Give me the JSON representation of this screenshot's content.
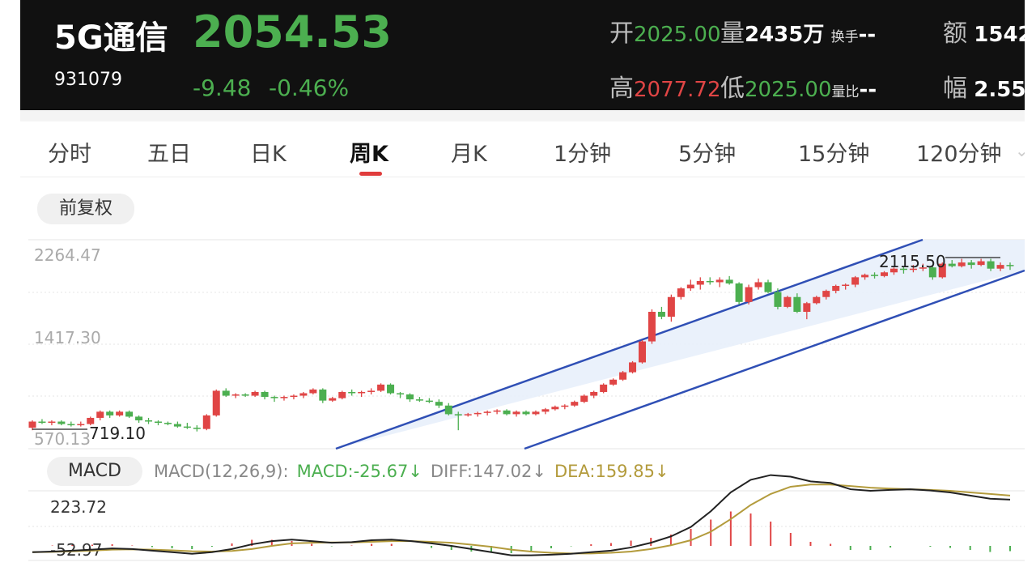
{
  "header": {
    "name": "5G通信",
    "code": "931079",
    "price": "2054.53",
    "change": "-9.48",
    "change_pct": "-0.46%",
    "open_label": "开",
    "open": "2025.00",
    "volume_label": "量",
    "volume": "2435万",
    "turnover_label": "换手",
    "turnover": "--",
    "amount_label": "额",
    "amount": "1542",
    "high_label": "高",
    "high": "2077.72",
    "low_label": "低",
    "low": "2025.00",
    "vol_ratio_label": "量比",
    "vol_ratio": "--",
    "amplitude_label": "幅",
    "amplitude": "2.55",
    "colors": {
      "up": "#e04545",
      "down": "#4caf50"
    }
  },
  "tabs": [
    "分时",
    "五日",
    "日K",
    "周K",
    "月K",
    "1分钟",
    "5分钟",
    "15分钟",
    "120分钟"
  ],
  "active_tab": "周K",
  "adjust_button": "前复权",
  "macd": {
    "button": "MACD",
    "params": "MACD(12,26,9):",
    "macd": "MACD:-25.67↓",
    "diff": "DIFF:147.02↓",
    "dea": "DEA:159.85↓"
  },
  "chart_data": {
    "type": "candlestick",
    "y_ticks": [
      "2264.47",
      "1417.30",
      "570.13"
    ],
    "y_range": [
      570.13,
      2264.47
    ],
    "annotations": {
      "max": "2115.50",
      "min": "719.10"
    },
    "channel": "upward parallel channel, shaded",
    "candles_ohlc": [
      [
        740,
        800,
        720,
        790
      ],
      [
        790,
        810,
        770,
        780
      ],
      [
        780,
        800,
        760,
        790
      ],
      [
        790,
        800,
        760,
        770
      ],
      [
        770,
        790,
        750,
        765
      ],
      [
        765,
        790,
        750,
        770
      ],
      [
        770,
        830,
        760,
        820
      ],
      [
        820,
        880,
        800,
        870
      ],
      [
        870,
        880,
        820,
        840
      ],
      [
        840,
        880,
        830,
        870
      ],
      [
        870,
        880,
        820,
        830
      ],
      [
        830,
        840,
        780,
        800
      ],
      [
        800,
        820,
        770,
        790
      ],
      [
        790,
        800,
        760,
        780
      ],
      [
        780,
        790,
        760,
        770
      ],
      [
        770,
        790,
        740,
        750
      ],
      [
        750,
        780,
        730,
        740
      ],
      [
        740,
        760,
        710,
        730
      ],
      [
        730,
        850,
        720,
        840
      ],
      [
        840,
        1050,
        830,
        1040
      ],
      [
        1040,
        1060,
        990,
        1000
      ],
      [
        1000,
        1020,
        980,
        1010
      ],
      [
        1010,
        1020,
        990,
        1000
      ],
      [
        1000,
        1040,
        990,
        1030
      ],
      [
        1030,
        1040,
        970,
        990
      ],
      [
        990,
        1000,
        950,
        980
      ],
      [
        980,
        1000,
        960,
        990
      ],
      [
        990,
        1010,
        970,
        1000
      ],
      [
        1000,
        1030,
        980,
        1020
      ],
      [
        1020,
        1060,
        1010,
        1050
      ],
      [
        1050,
        1060,
        940,
        960
      ],
      [
        960,
        990,
        950,
        980
      ],
      [
        980,
        1040,
        970,
        1030
      ],
      [
        1030,
        1050,
        1000,
        1020
      ],
      [
        1020,
        1040,
        990,
        1030
      ],
      [
        1030,
        1060,
        1010,
        1040
      ],
      [
        1040,
        1100,
        1030,
        1090
      ],
      [
        1090,
        1100,
        1010,
        1020
      ],
      [
        1020,
        1030,
        980,
        1010
      ],
      [
        1010,
        1020,
        950,
        970
      ],
      [
        970,
        990,
        950,
        960
      ],
      [
        960,
        980,
        940,
        950
      ],
      [
        950,
        970,
        900,
        920
      ],
      [
        920,
        940,
        840,
        850
      ],
      [
        850,
        870,
        720,
        840
      ],
      [
        840,
        860,
        830,
        850
      ],
      [
        850,
        870,
        830,
        860
      ],
      [
        860,
        880,
        840,
        870
      ],
      [
        870,
        890,
        850,
        880
      ],
      [
        880,
        890,
        840,
        850
      ],
      [
        850,
        880,
        830,
        870
      ],
      [
        870,
        880,
        840,
        850
      ],
      [
        850,
        880,
        840,
        870
      ],
      [
        870,
        900,
        850,
        890
      ],
      [
        890,
        920,
        880,
        910
      ],
      [
        910,
        930,
        890,
        920
      ],
      [
        920,
        960,
        910,
        950
      ],
      [
        950,
        1010,
        940,
        1000
      ],
      [
        1000,
        1040,
        980,
        1030
      ],
      [
        1030,
        1100,
        1020,
        1090
      ],
      [
        1090,
        1140,
        1080,
        1130
      ],
      [
        1130,
        1200,
        1120,
        1190
      ],
      [
        1190,
        1280,
        1180,
        1270
      ],
      [
        1270,
        1450,
        1260,
        1440
      ],
      [
        1440,
        1700,
        1420,
        1680
      ],
      [
        1680,
        1720,
        1620,
        1640
      ],
      [
        1640,
        1820,
        1600,
        1800
      ],
      [
        1800,
        1880,
        1780,
        1870
      ],
      [
        1870,
        1940,
        1850,
        1900
      ],
      [
        1900,
        1960,
        1860,
        1930
      ],
      [
        1930,
        1960,
        1900,
        1920
      ],
      [
        1920,
        1960,
        1880,
        1940
      ],
      [
        1940,
        1970,
        1900,
        1910
      ],
      [
        1910,
        1920,
        1740,
        1760
      ],
      [
        1760,
        1900,
        1740,
        1880
      ],
      [
        1880,
        1950,
        1860,
        1920
      ],
      [
        1920,
        1940,
        1830,
        1840
      ],
      [
        1840,
        1870,
        1700,
        1720
      ],
      [
        1720,
        1810,
        1710,
        1800
      ],
      [
        1800,
        1830,
        1670,
        1680
      ],
      [
        1680,
        1760,
        1620,
        1750
      ],
      [
        1750,
        1810,
        1740,
        1800
      ],
      [
        1800,
        1860,
        1780,
        1850
      ],
      [
        1850,
        1900,
        1830,
        1890
      ],
      [
        1890,
        1910,
        1860,
        1900
      ],
      [
        1900,
        1970,
        1880,
        1960
      ],
      [
        1960,
        1990,
        1940,
        1980
      ],
      [
        1980,
        2000,
        1950,
        1970
      ],
      [
        1970,
        2010,
        1960,
        2000
      ],
      [
        2000,
        2040,
        1980,
        2030
      ],
      [
        2030,
        2050,
        1990,
        2020
      ],
      [
        2020,
        2060,
        2000,
        2030
      ],
      [
        2030,
        2070,
        2010,
        2040
      ],
      [
        2040,
        2050,
        1940,
        1960
      ],
      [
        1960,
        2080,
        1950,
        2070
      ],
      [
        2070,
        2100,
        2040,
        2050
      ],
      [
        2050,
        2110,
        2040,
        2080
      ],
      [
        2080,
        2100,
        2030,
        2060
      ],
      [
        2060,
        2110,
        2050,
        2090
      ],
      [
        2090,
        2110,
        2010,
        2030
      ],
      [
        2030,
        2080,
        2010,
        2060
      ],
      [
        2060,
        2080,
        2020,
        2055
      ]
    ],
    "macd_series": {
      "y_ticks": [
        "223.72",
        "-52.97"
      ],
      "diff": [
        -20,
        -18,
        -15,
        -12,
        -8,
        -10,
        -15,
        -20,
        -25,
        -20,
        -10,
        5,
        15,
        20,
        15,
        10,
        12,
        18,
        20,
        15,
        8,
        0,
        -10,
        -20,
        -30,
        -30,
        -28,
        -25,
        -20,
        -15,
        -5,
        10,
        30,
        60,
        110,
        170,
        210,
        225,
        220,
        205,
        200,
        180,
        175,
        178,
        180,
        176,
        170,
        160,
        150,
        147
      ],
      "dea": [
        -20,
        -19,
        -17,
        -15,
        -12,
        -11,
        -12,
        -14,
        -17,
        -18,
        -16,
        -10,
        0,
        8,
        10,
        11,
        11,
        13,
        15,
        15,
        13,
        10,
        4,
        -3,
        -12,
        -18,
        -22,
        -24,
        -24,
        -22,
        -18,
        -10,
        2,
        18,
        45,
        85,
        130,
        165,
        188,
        195,
        195,
        190,
        185,
        182,
        180,
        178,
        175,
        170,
        165,
        160
      ]
    }
  }
}
